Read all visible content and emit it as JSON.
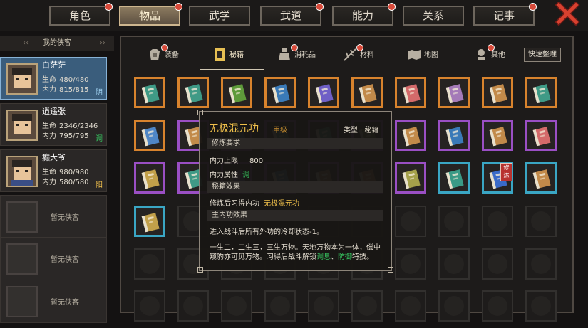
{
  "top_tabs": [
    {
      "label": "角色",
      "dot": true
    },
    {
      "label": "物品",
      "dot": true,
      "active": true
    },
    {
      "label": "武学",
      "dot": false
    },
    {
      "label": "武道",
      "dot": true
    },
    {
      "label": "能力",
      "dot": true
    },
    {
      "label": "关系",
      "dot": false
    },
    {
      "label": "记事",
      "dot": true
    }
  ],
  "sidebar": {
    "header": "我的侠客",
    "characters": [
      {
        "name": "白茫茫",
        "hp_label": "生命",
        "hp": "480/480",
        "mp_label": "内力",
        "mp": "815/815",
        "attr": "阴",
        "attr_color": "#9fd1f0"
      },
      {
        "name": "逍遥张",
        "hp_label": "生命",
        "hp": "2346/2346",
        "mp_label": "内力",
        "mp": "795/795",
        "attr": "调",
        "attr_color": "#36c25e"
      },
      {
        "name": "癫大爷",
        "hp_label": "生命",
        "hp": "980/980",
        "mp_label": "内力",
        "mp": "580/580",
        "attr": "阳",
        "attr_color": "#f0c04b"
      }
    ],
    "empty_label": "暂无侠客"
  },
  "categories": [
    {
      "label": "装备",
      "dot": true,
      "icon": "armor-icon"
    },
    {
      "label": "秘籍",
      "dot": false,
      "icon": "book-icon",
      "active": true
    },
    {
      "label": "消耗品",
      "dot": true,
      "icon": "potion-icon"
    },
    {
      "label": "材料",
      "dot": true,
      "icon": "herb-icon"
    },
    {
      "label": "地图",
      "dot": false,
      "icon": "map-icon"
    },
    {
      "label": "其他",
      "dot": true,
      "icon": "misc-icon"
    }
  ],
  "sort_button": "快速整理",
  "rarity_colors": {
    "orange": "#d8832d",
    "purple": "#9a4fc4",
    "teal": "#3aa6c4"
  },
  "inventory": [
    {
      "frame": "orange",
      "cover": "#3f9a86"
    },
    {
      "frame": "orange",
      "cover": "#3f9a86"
    },
    {
      "frame": "orange",
      "cover": "#5e9a3a"
    },
    {
      "frame": "orange",
      "cover": "#3a7ab8"
    },
    {
      "frame": "orange",
      "cover": "#6f5fc6"
    },
    {
      "frame": "orange",
      "cover": "#c28a4a"
    },
    {
      "frame": "orange",
      "cover": "#d46a6a"
    },
    {
      "frame": "orange",
      "cover": "#a47ab8"
    },
    {
      "frame": "orange",
      "cover": "#c28a4a"
    },
    {
      "frame": "orange",
      "cover": "#3f9a86"
    },
    {
      "frame": "orange",
      "cover": "#4f86c6"
    },
    {
      "frame": "purple",
      "cover": "#c28a4a"
    },
    {
      "frame": "purple",
      "cover": "#3a7ab8"
    },
    {
      "frame": "purple",
      "cover": "#3f9a86"
    },
    {
      "frame": "purple",
      "cover": "#3f9a86"
    },
    {
      "frame": "purple",
      "cover": "#6a8a3a"
    },
    {
      "frame": "purple",
      "cover": "#c28a4a"
    },
    {
      "frame": "purple",
      "cover": "#3a7ab8"
    },
    {
      "frame": "purple",
      "cover": "#c28a4a"
    },
    {
      "frame": "purple",
      "cover": "#d46a6a"
    },
    {
      "frame": "purple",
      "cover": "#c2a04a"
    },
    {
      "frame": "purple",
      "cover": "#3f9a86"
    },
    {
      "frame": "purple",
      "cover": "#6f5fc6"
    },
    {
      "frame": "purple",
      "cover": "#3a7ab8"
    },
    {
      "frame": "purple",
      "cover": "#a4885a"
    },
    {
      "frame": "purple",
      "cover": "#c28a4a"
    },
    {
      "frame": "purple",
      "cover": "#a4a04a"
    },
    {
      "frame": "teal",
      "cover": "#3a9a86"
    },
    {
      "frame": "teal",
      "cover": "#3a6ac8",
      "badge": "修炼"
    },
    {
      "frame": "teal",
      "cover": "#c28a4a"
    },
    {
      "frame": "teal",
      "cover": "#c2a04a"
    }
  ],
  "tooltip": {
    "title": "无极混元功",
    "grade": "甲级",
    "type_label": "类型",
    "type_value": "秘籍",
    "sec_requirements": "修炼要求",
    "req_label": "内力上限",
    "req_value": "800",
    "attr_label": "内力属性",
    "attr_value": "调",
    "sec_effect": "秘籍效果",
    "effect_label": "修炼后习得内功",
    "effect_value": "无极混元功",
    "sec_main": "主内功效果",
    "main_effect": "进入战斗后所有外功的冷却状态-1。",
    "desc_1": "一生二，二生三，三生万物。天地万物本为一体，偿中窥豹亦可见万物。习得后战斗解锁",
    "desc_hl1": "调息",
    "desc_sep": "、",
    "desc_hl2": "防御",
    "desc_2": "特技。"
  }
}
